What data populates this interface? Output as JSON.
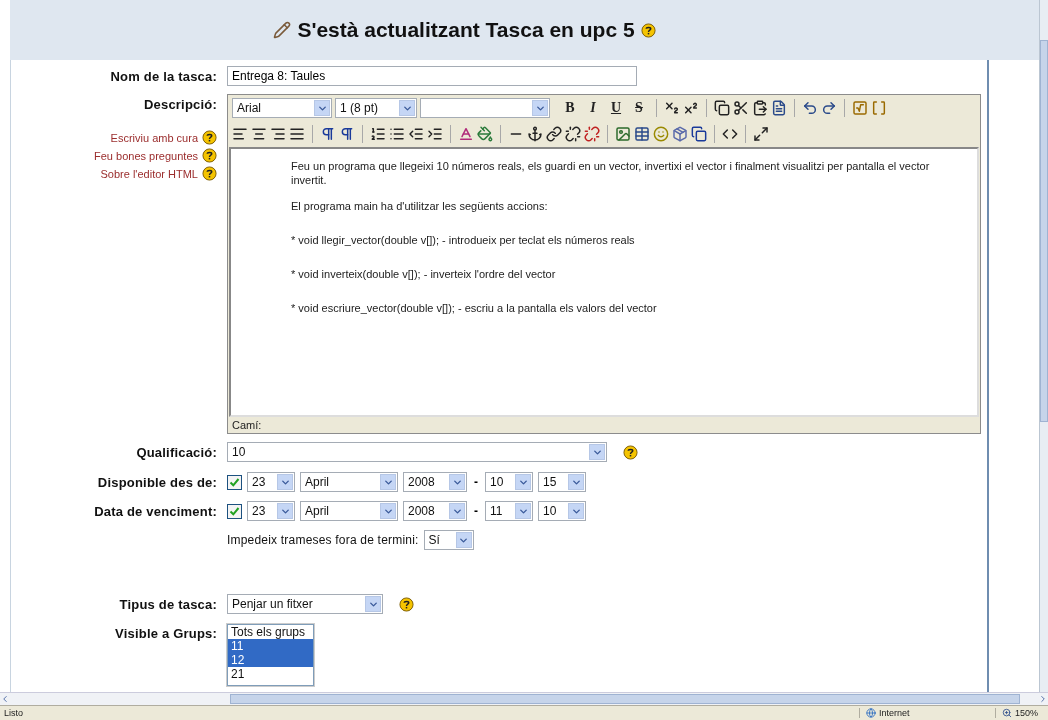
{
  "page": {
    "title": "S'està actualitzant Tasca en upc 5"
  },
  "name_field": {
    "label": "Nom de la tasca:",
    "value": "Entrega 8: Taules"
  },
  "description": {
    "label": "Descripció:",
    "help_links": [
      "Escriviu amb cura",
      "Feu bones preguntes",
      "Sobre l'editor HTML"
    ],
    "font_select": "Arial",
    "size_select": "1 (8 pt)",
    "text_buttons": [
      "B",
      "I",
      "U",
      "S"
    ],
    "paragraphs": [
      "Feu un programa que llegeixi  10 números reals, els guardi en un vector, invertixi el vector i  finalment visualitzi per pantalla el vector invertit.",
      "El programa main ha d'utilitzar les següents accions:",
      "* void llegir_vector(double v[]); - introdueix per teclat els números reals",
      "* void inverteix(double v[]); - inverteix l'ordre del vector",
      "* void escriure_vector(double v[]); - escriu a la pantalla els valors del vector"
    ],
    "path_label": "Camí:"
  },
  "grade": {
    "label": "Qualificació:",
    "value": "10"
  },
  "dates": [
    {
      "label": "Disponible des de:",
      "enabled": true,
      "day": "23",
      "month": "April",
      "year": "2008",
      "separator": "-",
      "hour": "10",
      "minute": "15"
    },
    {
      "label": "Data de venciment:",
      "enabled": true,
      "day": "23",
      "month": "April",
      "year": "2008",
      "separator": "-",
      "hour": "11",
      "minute": "10"
    }
  ],
  "prevent_late": {
    "label": "Impedeix trameses fora de termini:",
    "value": "Sí"
  },
  "task_type": {
    "label": "Tipus de tasca:",
    "value": "Penjar un fitxer"
  },
  "groups": {
    "label": "Visible a Grups:",
    "options": [
      {
        "label": "Tots els grups",
        "selected": false
      },
      {
        "label": "11",
        "selected": true
      },
      {
        "label": "12",
        "selected": true
      },
      {
        "label": "21",
        "selected": false
      }
    ]
  },
  "status_bar": {
    "status": "Listo",
    "zone": "Internet",
    "zoom": "150%"
  }
}
